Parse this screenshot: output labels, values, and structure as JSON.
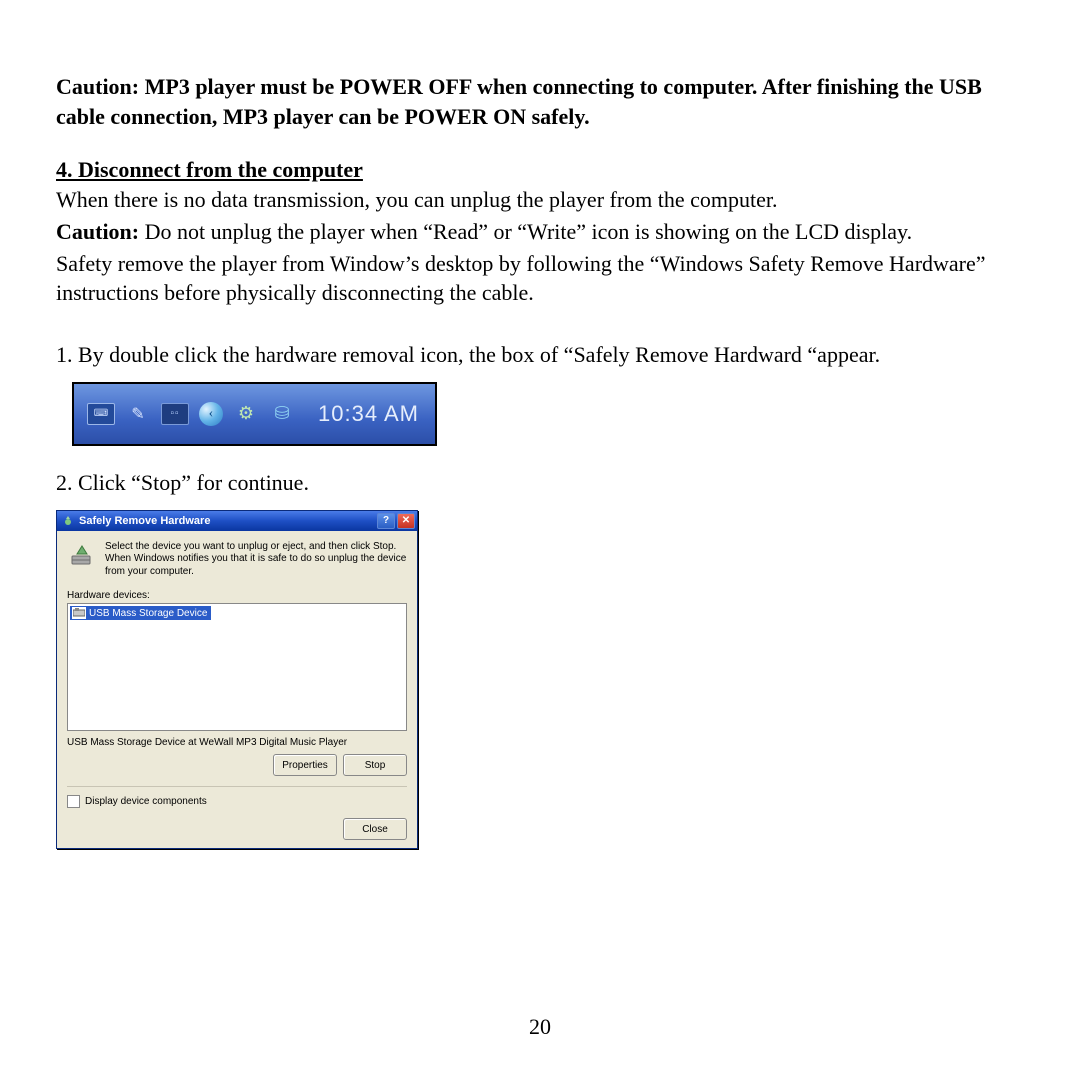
{
  "document": {
    "caution_top": "Caution: MP3 player must be POWER OFF when connecting to computer. After finishing the USB cable connection, MP3 player can be POWER ON safely.",
    "section_title": "4. Disconnect from the computer",
    "para_when": "When there is no data transmission, you can unplug the player from the computer.",
    "para_caution_label": "Caution:",
    "para_caution_body": " Do not unplug the player when “Read” or “Write” icon is showing on the LCD display.",
    "para_safety": "Safety remove the player from Window’s desktop by following the “Windows Safety Remove Hardware” instructions before physically disconnecting the cable.",
    "step1": "1. By double click the hardware removal icon, the box of “Safely Remove Hardward “appear.",
    "step2": "2.  Click “Stop” for continue.",
    "page_number": "20"
  },
  "taskbar": {
    "time": "10:34 AM",
    "icons": {
      "keyboard": "⌨",
      "pen": "✎",
      "da": "▫▫",
      "back": "‹",
      "gear": "⚙",
      "usb": "⛁"
    }
  },
  "dialog": {
    "title": "Safely Remove Hardware",
    "help_symbol": "?",
    "close_symbol": "✕",
    "info_text": "Select the device you want to unplug or eject, and then click Stop. When Windows notifies you that it is safe to do so unplug the device from your computer.",
    "hardware_label": "Hardware devices:",
    "device_item": "USB Mass Storage Device",
    "device_desc": "USB Mass Storage Device at WeWall MP3 Digital Music Player",
    "btn_properties": "Properties",
    "btn_stop": "Stop",
    "checkbox_label": "Display device components",
    "btn_close": "Close"
  }
}
